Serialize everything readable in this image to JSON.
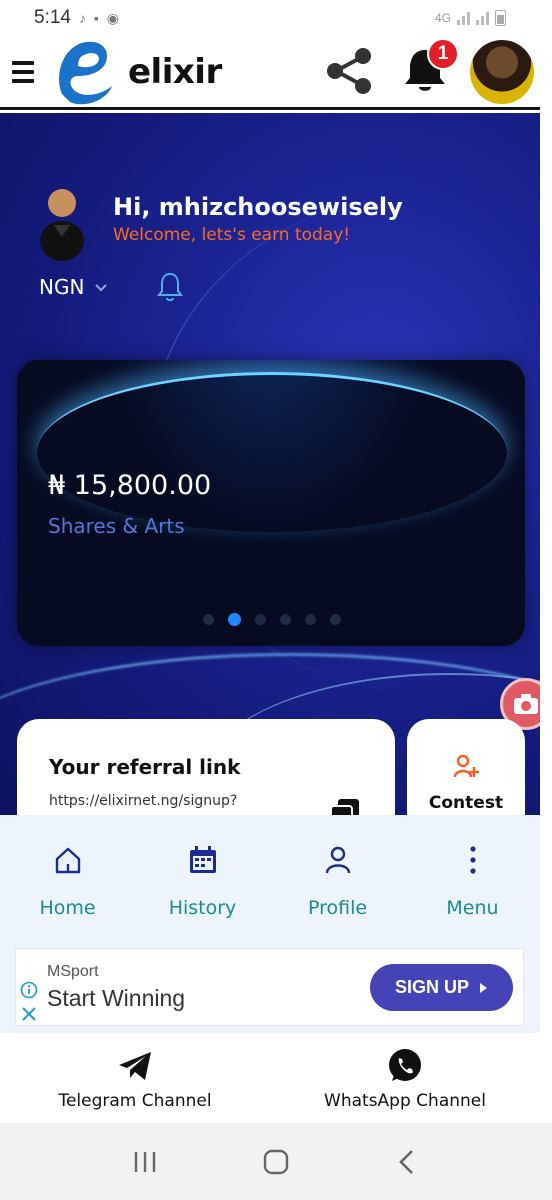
{
  "status_bar": {
    "time": "5:14",
    "network": "4G"
  },
  "header": {
    "brand": "elixir",
    "notification_count": "1"
  },
  "hero": {
    "greeting": "Hi, mhizchoosewisely",
    "welcome": "Welcome, lets's earn today!",
    "currency": "NGN"
  },
  "balance_card": {
    "amount": "₦ 15,800.00",
    "plan": "Shares & Arts",
    "page_count": 6,
    "active_page": 2
  },
  "referral": {
    "title": "Your referral link",
    "link": "https://elixirnet.ng/signup?"
  },
  "contest": {
    "label": "Contest"
  },
  "bottom_nav": {
    "items": [
      {
        "label": "Home",
        "icon": "home-icon"
      },
      {
        "label": "History",
        "icon": "calendar-icon"
      },
      {
        "label": "Profile",
        "icon": "person-icon"
      },
      {
        "label": "Menu",
        "icon": "more-vertical-icon"
      }
    ]
  },
  "ad": {
    "brand": "MSport",
    "headline": "Start Winning",
    "cta": "SIGN UP"
  },
  "channels": {
    "telegram": "Telegram Channel",
    "whatsapp": "WhatsApp Channel"
  },
  "colors": {
    "hero_bg": "#1c2596",
    "accent_orange": "#ff6a21",
    "nav_teal": "#1a8a93",
    "nav_icon": "#1c2c8f",
    "ad_button": "#4444b6",
    "badge_red": "#e21f26"
  }
}
